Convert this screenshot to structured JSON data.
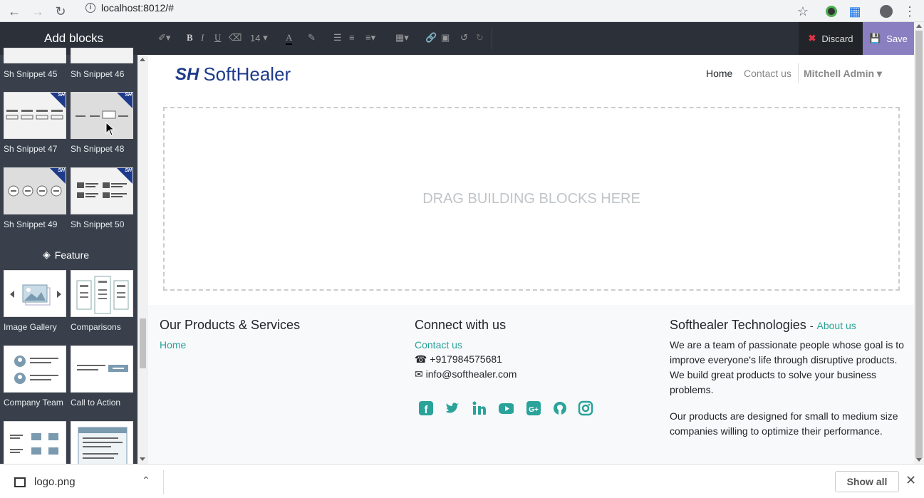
{
  "browser": {
    "url": "localhost:8012/#"
  },
  "sidebar": {
    "title": "Add blocks",
    "snippets": [
      {
        "label": "Sh Snippet 45"
      },
      {
        "label": "Sh Snippet 46"
      },
      {
        "label": "Sh Snippet 47"
      },
      {
        "label": "Sh Snippet 48"
      },
      {
        "label": "Sh Snippet 49"
      },
      {
        "label": "Sh Snippet 50"
      }
    ],
    "feature_heading": "Feature",
    "features": [
      {
        "label": "Image Gallery"
      },
      {
        "label": "Comparisons"
      },
      {
        "label": "Company Team"
      },
      {
        "label": "Call to Action"
      }
    ],
    "badge": "SH"
  },
  "toolbar": {
    "font_size": "14",
    "discard_label": "Discard",
    "save_label": "Save"
  },
  "site": {
    "logo_mark": "SH",
    "logo_text": "SoftHealer",
    "nav": {
      "home": "Home",
      "contact": "Contact us",
      "user": "Mitchell Admin"
    },
    "dropzone_text": "DRAG BUILDING BLOCKS HERE",
    "footer": {
      "col1_title": "Our Products & Services",
      "col1_link": "Home",
      "col2_title": "Connect with us",
      "col2_link": "Contact us",
      "phone": "+917984575681",
      "email": "info@softhealer.com",
      "col3_title": "Softhealer Technologies",
      "col3_sep": "-",
      "col3_link": "About us",
      "para1": "We are a team of passionate people whose goal is to improve everyone's life through disruptive products. We build great products to solve your business problems.",
      "para2": "Our products are designed for small to medium size companies willing to optimize their performance."
    }
  },
  "downloads": {
    "filename": "logo.png",
    "show_all": "Show all"
  },
  "colors": {
    "accent": "#2aa39a",
    "save_bg": "#8a7fc0",
    "brand": "#1e3a8a"
  }
}
